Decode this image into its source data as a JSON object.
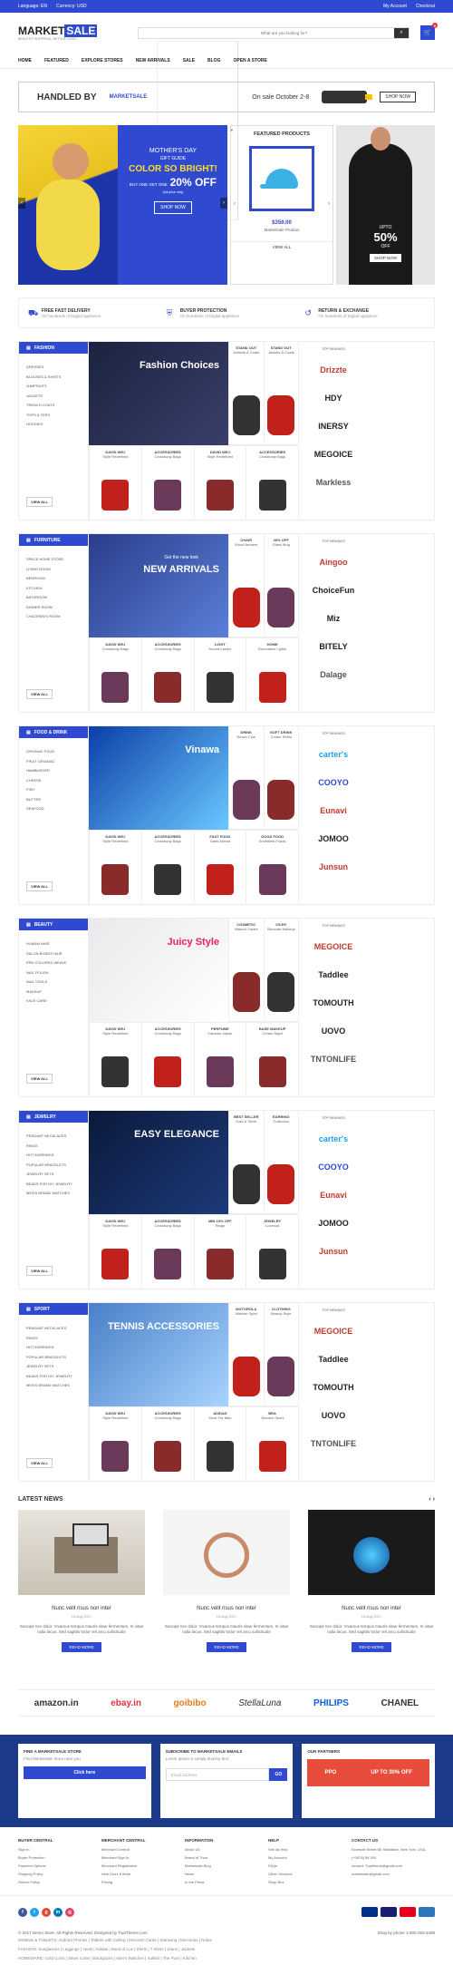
{
  "topbar": {
    "language": "Language: EN",
    "currency": "Currency: USD",
    "account": "My Account",
    "checkout": "Checkout"
  },
  "header": {
    "logo_main": "MARKET",
    "logo_accent": "SALE",
    "tagline": "BEAUTIFY SHOPPING, BETTER LIVING",
    "category": "All Categories",
    "search_placeholder": "What are you looking for?",
    "cart_count": "0"
  },
  "nav": [
    "HOME",
    "FEATURED",
    "EXPLORE STORES",
    "NEW ARRIVALS",
    "SALE",
    "BLOG",
    "OPEN A STORE"
  ],
  "banner_ad": {
    "headline": "HANDLED BY",
    "brand": "MARKETSALE",
    "sale": "On sale October 2-8",
    "shop": "SHOP NOW"
  },
  "hero": {
    "t1": "MOTHER'S DAY",
    "t2": "GIFT GUIDE",
    "t3": "COLOR SO BRIGHT!",
    "t4": "BUY ONE GET ONE",
    "t5": "20% OFF",
    "t6": "(full price only)",
    "btn": "SHOP NOW",
    "featured_title": "FEATURED PRODUCTS",
    "featured_price": "$359.00",
    "featured_name": "Marketsale Product",
    "view_all": "VIEW ALL",
    "side_t1": "UPTO",
    "side_pct": "50%",
    "side_t2": "OFF",
    "side_btn": "SHOP NOW"
  },
  "services": [
    {
      "title": "FREE FAST DELIVERY",
      "sub": "On hundreds of Digital appliance"
    },
    {
      "title": "BUYER PROTECTION",
      "sub": "On hundreds of Digital appliance"
    },
    {
      "title": "RETURN & EXCHANGE",
      "sub": "On hundreds of Digital appliance"
    }
  ],
  "categories": [
    {
      "name": "FASHION",
      "items": [
        "DRESSES",
        "BLOUSES & SHIRTS",
        "JUMPSUITS",
        "JACKETS",
        "TRENCH COATS",
        "TOPS & TEES",
        "HOODIES"
      ],
      "banner": "Fashion Choices",
      "banner_sub": "",
      "top": [
        [
          "STAND OUT",
          "Jackets & Coats"
        ],
        [
          "STAND OUT",
          "Jackets & Coats"
        ]
      ],
      "bottom": [
        [
          "DAVID WEJ",
          "Style Redefined"
        ],
        [
          "ACCESSORIES",
          "Crossbody Bags"
        ],
        [
          "DAVID WEJ",
          "Style Redefined"
        ],
        [
          "ACCESSORIES",
          "Crossbody Bags"
        ]
      ],
      "brands": [
        "Drizzte",
        "HDY",
        "INERSY",
        "MEGOICE",
        "Markless"
      ]
    },
    {
      "name": "FURNITURE",
      "items": [
        "SPACE HOME STORE",
        "LIVING ROOM",
        "BEDROOM",
        "KITCHEN",
        "BATHROOM",
        "DINNER ROOM",
        "CHILDREN'S ROOM"
      ],
      "banner": "NEW ARRIVALS",
      "banner_sub": "Get the new look",
      "top": [
        [
          "CHAIR",
          "Wood Armrest"
        ],
        [
          "20% OFF",
          "Glass Mug"
        ]
      ],
      "bottom": [
        [
          "DAVID WEJ",
          "Crossbody Bags"
        ],
        [
          "ACCESSORIES",
          "Crossbody Bags"
        ],
        [
          "LIGHT",
          "Round Lamps"
        ],
        [
          "HOME",
          "Decorative Lights"
        ]
      ],
      "brands": [
        "Aingoo",
        "ChoiceFun",
        "Miz",
        "BITELY",
        "Dalage"
      ]
    },
    {
      "name": "FOOD & DRINK",
      "items": [
        "ORGANIC FOOD",
        "FRUIT ORGANIC",
        "HAMBURGER",
        "CHEESE",
        "FISH",
        "BUTTER",
        "SEAFOOD"
      ],
      "banner": "Vinawa",
      "banner_sub": "",
      "top": [
        [
          "DRINK",
          "Brown Cool"
        ],
        [
          "SOFT DRINK",
          "Cream Refris"
        ]
      ],
      "bottom": [
        [
          "DAVID WEJ",
          "Style Redefined"
        ],
        [
          "ACCESSORIES",
          "Crossbody Bags"
        ],
        [
          "FAST FOOD",
          "Garlic Bread"
        ],
        [
          "GOOD FOOD",
          "Smithfield Foods"
        ]
      ],
      "brands": [
        "carter's",
        "COOYO",
        "Eunavi",
        "JOMOO",
        "Junsun"
      ]
    },
    {
      "name": "BEAUTY",
      "items": [
        "HUMAN HAIR",
        "SALON BONDS HAIR",
        "PRE-COLORED WEAVE",
        "NAIL POLISH",
        "NAIL TOOLS",
        "MAKEUP",
        "FACE CARE"
      ],
      "banner": "Juicy Style",
      "banner_sub": "",
      "top": [
        [
          "COSMETIC",
          "Natural Cream"
        ],
        [
          "VICHY",
          "Skincare Makeup"
        ]
      ],
      "bottom": [
        [
          "DAVID WEJ",
          "Style Redefined"
        ],
        [
          "ACCESSORIES",
          "Crossbody Bags"
        ],
        [
          "PERFUME",
          "Kamebo Japan"
        ],
        [
          "BASE MAKEUP",
          "Cream Night"
        ]
      ],
      "brands": [
        "MEGOICE",
        "Taddlee",
        "TOMOUTH",
        "UOVO",
        "TNTONLIFE"
      ]
    },
    {
      "name": "JEWELRY",
      "items": [
        "PENDANT NECKLACES",
        "RINGS",
        "HOT EARRINGS",
        "POPULAR BRACELETS",
        "JEWELRY SETS",
        "BEADS FOR DIY JEWELRY",
        "MEN'S BRAND WATCHES"
      ],
      "banner": "EASY ELEGANCE",
      "banner_sub": "",
      "top": [
        [
          "BEST SELLER",
          "Gold & Silver"
        ],
        [
          "EARRING",
          "Collection"
        ]
      ],
      "bottom": [
        [
          "DAVID WEJ",
          "Style Redefined"
        ],
        [
          "ACCESSORIES",
          "Crossbody Bags"
        ],
        [
          "MIN 15% OFF",
          "Rings"
        ],
        [
          "JEWELRY",
          "Locenza"
        ]
      ],
      "brands": [
        "carter's",
        "COOYO",
        "Eunavi",
        "JOMOO",
        "Junsun"
      ]
    },
    {
      "name": "SPORT",
      "items": [
        "PENDANT NECKLACES",
        "RINGS",
        "HOT EARRINGS",
        "POPULAR BRACELETS",
        "JEWELRY SETS",
        "BEADS FOR DIY JEWELRY",
        "MEN'S BRAND WATCHES"
      ],
      "banner": "TENNIS ACCESSORIES",
      "banner_sub": "",
      "top": [
        [
          "MOTOROLA",
          "Watche Sport"
        ],
        [
          "CLOTHING",
          "Beauty Style"
        ]
      ],
      "bottom": [
        [
          "DAVID WEJ",
          "Style Redefined"
        ],
        [
          "ACCESSORIES",
          "Crossbody Bags"
        ],
        [
          "ADIDAS",
          "Shoe For Men"
        ],
        [
          "BRA",
          "Women Sport"
        ]
      ],
      "brands": [
        "MEGOICE",
        "Taddlee",
        "TOMOUTH",
        "UOVO",
        "TNTONLIFE"
      ]
    }
  ],
  "news": {
    "title": "LATEST NEWS",
    "items": [
      {
        "t": "Nunc velit risus non inter",
        "m": "15 Aug 2017",
        "d": "Suscipit nec dolor. Vivamus tempus mauris vitae fermentum. In vitae nulla lacus. Sed sagittis tortor vel arcu sollicitudin"
      },
      {
        "t": "Nunc velit risus non inter",
        "m": "15 Aug 2017",
        "d": "Suscipit nec dolor. Vivamus tempus mauris vitae fermentum. In vitae nulla lacus. Sed sagittis tortor vel arcu sollicitudin"
      },
      {
        "t": "Nunc velit risus non inter",
        "m": "15 Aug 2017",
        "d": "Suscipit nec dolor. Vivamus tempus mauris vitae fermentum. In vitae nulla lacus. Sed sagittis tortor vel arcu sollicitudin"
      }
    ],
    "read_more": "READ MORE"
  },
  "partners": [
    "amazon.in",
    "ebay.in",
    "goibibo",
    "StellaLuna",
    "PHILIPS",
    "CHANEL"
  ],
  "footerbar": {
    "store_title": "FIND A MARKETSALE STORE",
    "store_sub": "Find Marketsale Store near you",
    "store_btn": "Click here",
    "email_title": "SUBSCRIBE TO MARKETSALE EMAILS",
    "email_sub": "Lorem Ipsum is simply dummy text",
    "email_ph": "Email Address",
    "email_btn": "GO",
    "partner_title": "OUR PARTNERS",
    "partner_logo": "PPO",
    "partner_text": "UP TO 30% OFF"
  },
  "footer": [
    {
      "h": "BUYER CENTRAL",
      "items": [
        "Sign In",
        "Buyer Protection",
        "Payment Options",
        "Shipping Policy",
        "Return Policy"
      ]
    },
    {
      "h": "MERCHANT CENTRAL",
      "items": [
        "Merchant Central",
        "Merchant Sign In",
        "Merchant Registration",
        "How Does It Work",
        "Pricing"
      ]
    },
    {
      "h": "INFORMATION",
      "items": [
        "About Us",
        "Brand of Trust",
        "Marketsale Blog",
        "News",
        "In the Press"
      ]
    },
    {
      "h": "HELP",
      "items": [
        "See all Help",
        "My Account",
        "FAQs",
        "Other Services",
        "Shop Bus"
      ]
    },
    {
      "h": "CONTACT US",
      "items": [
        "Example Street 68, Mahattan, New York, USA.",
        "(+0678) 56 000",
        "contact: Tupitheme@gmail.com",
        "marketsale@gmail.com"
      ]
    }
  ],
  "bottom": {
    "copyright": "© 2017 Demo Store. All Rights Reserved. Designed by TupiTheme.com",
    "support": "Shop by phone 1-800-353-2288",
    "links1": "MOBILE & TABLETS: Android Phones | Tablets with Calling | MicroSD Cards | Samsung | Micromax | Nokia",
    "links2": "FASHION: Sunglasses | Leggings | Vests | Adidas | Band of Lux | Shirts | T-shirts | Jeans | Jackets",
    "links3": "HOMEWARE: Gold Coins | Silver Coins | Backpacks | Men's Watches | Sukkhi | The Pure | Kitchen"
  }
}
